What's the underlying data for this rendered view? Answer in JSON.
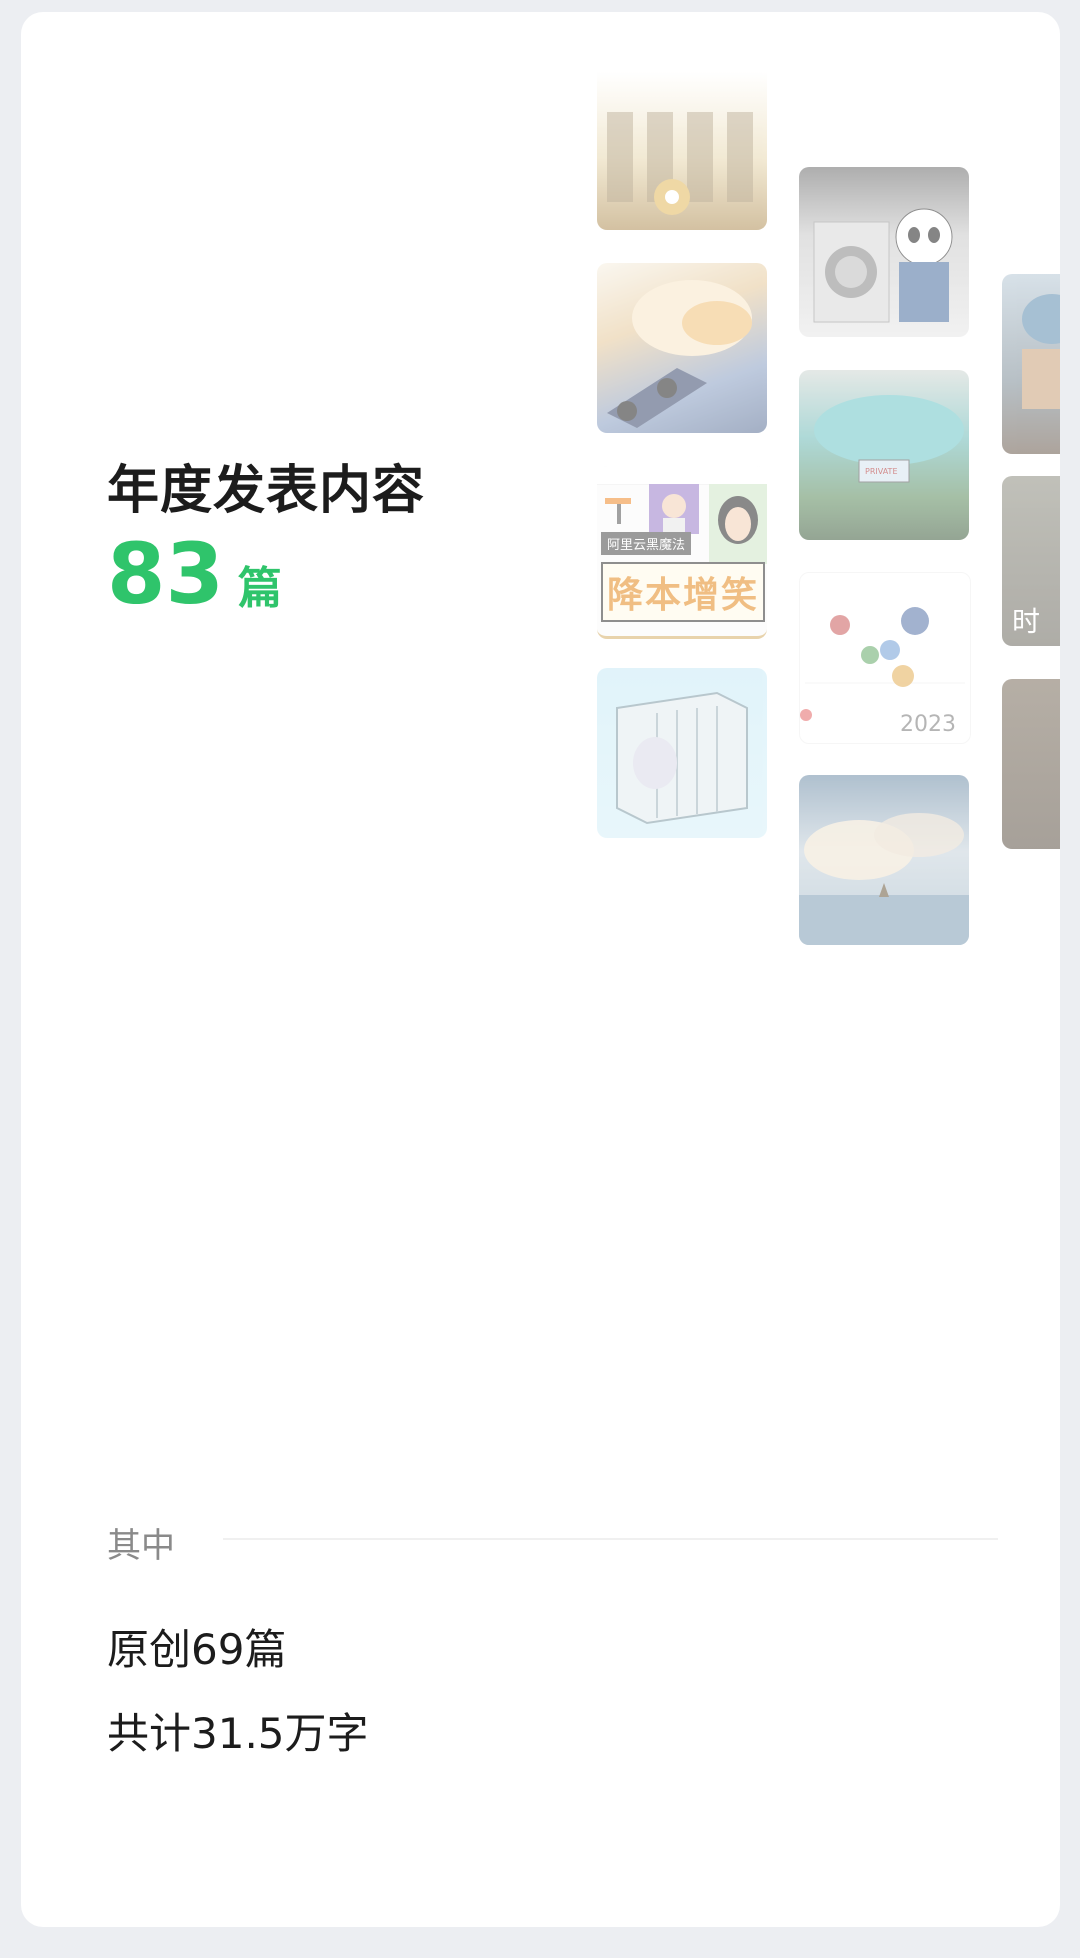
{
  "headline": "年度发表内容",
  "count": {
    "value": "83",
    "unit": "篇"
  },
  "thumbnails": {
    "label_black_magic": "阿里云黑魔法",
    "label_cost_down": "降本增笑",
    "label_year": "2023",
    "label_partial": "时"
  },
  "breakdown": {
    "section_label": "其中",
    "original": "原创69篇",
    "total_words": "共计31.5万字"
  },
  "colors": {
    "accent": "#2fc46b",
    "background": "#eceef2",
    "card": "#ffffff"
  }
}
